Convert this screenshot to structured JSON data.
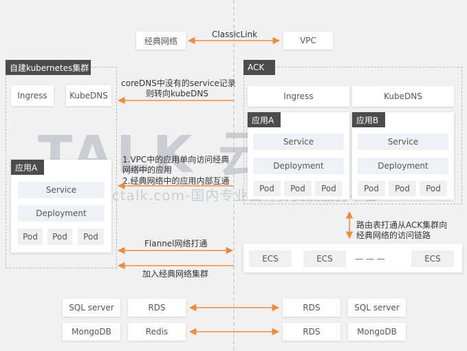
{
  "top": {
    "classic_box": "经典网络",
    "vpc_box": "VPC",
    "classiclink_label": "ClassicLink"
  },
  "self_built": {
    "title": "自建kubernetes集群",
    "ingress": "Ingress",
    "kubedns": "KubeDNS",
    "app_title": "应用A",
    "service": "Service",
    "deployment": "Deployment",
    "pods": [
      "Pod",
      "Pod",
      "Pod"
    ]
  },
  "ack": {
    "title": "ACK",
    "ingress": "Ingress",
    "kubedns": "KubeDNS",
    "app_a": {
      "title": "应用A",
      "service": "Service",
      "deployment": "Deployment",
      "pods": [
        "Pod",
        "Pod",
        "Pod"
      ]
    },
    "app_b": {
      "title": "应用B",
      "service": "Service",
      "deployment": "Deployment",
      "pods": [
        "Pod",
        "Pod",
        "Pod"
      ]
    },
    "ecs": [
      "ECS",
      "ECS",
      "— — —",
      "ECS"
    ]
  },
  "notes": {
    "coredns_line1": "coreDNS中没有的service记录",
    "coredns_line2": "则转向kubeDNS",
    "vpc_note_line1": "1.VPC中的应用单向访问经典",
    "vpc_note_line2": "网络中的应用",
    "vpc_note_line3": "2.经典网络中的应用内部互通",
    "flannel": "Flannel网络打通",
    "join_classic": "加入经典网络集群",
    "route_line1": "路由表打通从ACK集群向",
    "route_line2": "经典网络的访问链路"
  },
  "databases": {
    "left_row1": [
      "SQL server",
      "RDS"
    ],
    "left_row2": [
      "MongoDB",
      "Redis"
    ],
    "right_row1": [
      "RDS",
      "SQL server"
    ],
    "right_row2": [
      "RDS",
      "MongoDB"
    ]
  },
  "watermark": {
    "brand": "TALK 云说",
    "url": "www.idctalk.com-国内专业云计算交流服务平台-"
  },
  "colors": {
    "arrow": "#f08a3c",
    "title_bg": "#4c4c4c",
    "bar_bg": "#eef1f5"
  }
}
